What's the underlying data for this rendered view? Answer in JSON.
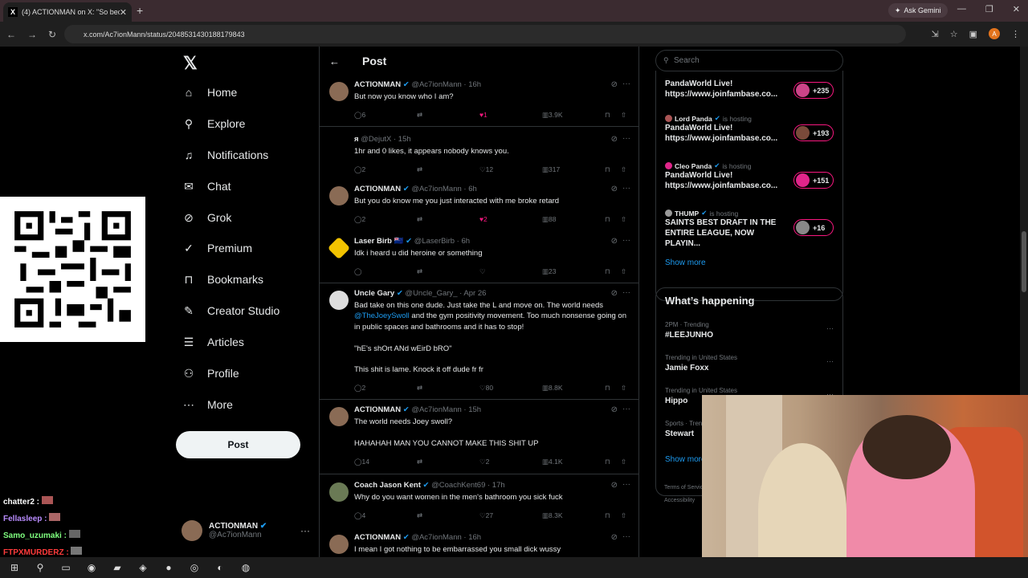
{
  "browser": {
    "tab_title": "(4) ACTIONMAN on X: \"So beca",
    "url": "x.com/Ac7ionMann/status/2048531430188179843",
    "ask_gemini": "Ask Gemini",
    "profile_initial": "A"
  },
  "sidebar": {
    "items": [
      {
        "label": "Home",
        "icon": "⌂"
      },
      {
        "label": "Explore",
        "icon": "⚲"
      },
      {
        "label": "Notifications",
        "icon": "♫"
      },
      {
        "label": "Chat",
        "icon": "✉"
      },
      {
        "label": "Grok",
        "icon": "⊘"
      },
      {
        "label": "Premium",
        "icon": "✓"
      },
      {
        "label": "Bookmarks",
        "icon": "⊓"
      },
      {
        "label": "Creator Studio",
        "icon": "✎"
      },
      {
        "label": "Articles",
        "icon": "☰"
      },
      {
        "label": "Profile",
        "icon": "⚇"
      },
      {
        "label": "More",
        "icon": "⋯"
      }
    ],
    "post_label": "Post",
    "account_name": "ACTIONMAN",
    "account_handle": "@Ac7ionMann"
  },
  "header": {
    "title": "Post"
  },
  "tweets": [
    {
      "name": "ACTIONMAN",
      "handle": "@Ac7ionMann · 16h",
      "text": "But now you know who I am?",
      "replies": "6",
      "likes": "1",
      "views": "3.9K",
      "liked": true
    },
    {
      "name": "я",
      "handle": "@DejutX · 15h",
      "text": "1hr and 0 likes, it appears nobody knows you.",
      "replies": "2",
      "likes": "12",
      "views": "317",
      "liked": false
    },
    {
      "name": "ACTIONMAN",
      "handle": "@Ac7ionMann · 6h",
      "text": "But you do know me you just interacted with me broke retard",
      "replies": "2",
      "likes": "2",
      "views": "88",
      "liked": true
    },
    {
      "name": "Laser Birb 🇳🇿",
      "handle": "@LaserBirb · 6h",
      "text": "Idk i heard u did heroine or something",
      "replies": "",
      "likes": "",
      "views": "23",
      "liked": false
    },
    {
      "name": "Uncle Gary",
      "handle": "@Uncle_Gary_ · Apr 26",
      "text_a": "Bad take on this one dude. Just take the L and move on. The world needs ",
      "mention": "@TheJoeySwoll",
      "text_b": " and the gym positivity movement. Too much nonsense going on in public spaces and bathrooms and it has to stop!\n\n\"hE's shOrt ANd wEirD bRO\"\n\nThis shit is lame. Knock it off dude fr fr",
      "replies": "2",
      "likes": "80",
      "views": "8.8K",
      "liked": false
    },
    {
      "name": "ACTIONMAN",
      "handle": "@Ac7ionMann · 15h",
      "text": "The world needs Joey swoll?\n\nHAHAHAH MAN YOU CANNOT MAKE THIS SHIT UP",
      "replies": "14",
      "likes": "2",
      "views": "4.1K",
      "liked": false
    },
    {
      "name": "Coach Jason Kent",
      "handle": "@CoachKent69 · 17h",
      "text": "Why do you want women in the men's bathroom you sick fuck",
      "replies": "4",
      "likes": "27",
      "views": "8.3K",
      "liked": false
    },
    {
      "name": "ACTIONMAN",
      "handle": "@Ac7ionMann · 16h",
      "text": "I mean I got nothing to be embarrassed you small dick wussy",
      "replies": "",
      "likes": "",
      "views": "",
      "liked": false
    }
  ],
  "search": {
    "placeholder": "Search"
  },
  "spaces": [
    {
      "host": "",
      "title": "PandaWorld Live!\nhttps://www.joinfambase.co...",
      "count": "+235"
    },
    {
      "host": "Lord Panda",
      "title": "PandaWorld Live!\nhttps://www.joinfambase.co...",
      "count": "+193"
    },
    {
      "host": "Cleo Panda",
      "title": "PandaWorld Live!\nhttps://www.joinfambase.co...",
      "count": "+151"
    },
    {
      "host": "THUMP",
      "title": "SAINTS BEST DRAFT IN THE\nENTIRE LEAGUE, NOW PLAYIN...",
      "count": "+16"
    }
  ],
  "is_hosting": "is hosting",
  "show_more": "Show more",
  "happening": {
    "title": "What’s happening",
    "trends": [
      {
        "cat": "2PM · Trending",
        "name": "#LEEJUNHO"
      },
      {
        "cat": "Trending in United States",
        "name": "Jamie Foxx"
      },
      {
        "cat": "Trending in United States",
        "name": "Hippo"
      },
      {
        "cat": "Sports · Trending",
        "name": "Stewart"
      }
    ],
    "show_more": "Show more"
  },
  "footer": {
    "terms": "Terms of Service",
    "access": "Accessibility"
  },
  "chat": [
    {
      "user": "chatter2 :",
      "color": "#ffffff"
    },
    {
      "user": "Fellasleep :",
      "color": "#b98cff"
    },
    {
      "user": "Samo_uzumaki :",
      "color": "#7fff7f"
    },
    {
      "user": "FTPXMURDERZ :",
      "color": "#ff3b3b"
    }
  ]
}
